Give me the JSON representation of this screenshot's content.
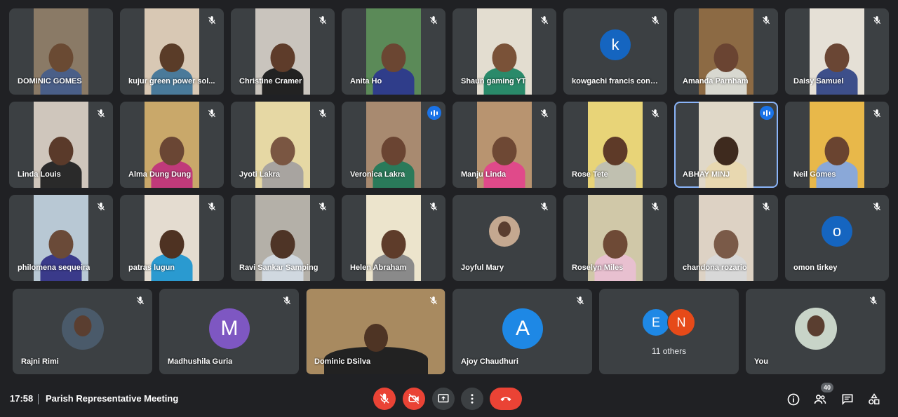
{
  "meeting": {
    "time": "17:58",
    "title": "Parish Representative Meeting",
    "participant_count": "40"
  },
  "colors": {
    "background": "#202124",
    "tile": "#3c4043",
    "danger": "#ea4335",
    "speaking_outline": "#8ab4f8",
    "speaking_badge": "#1a73e8"
  },
  "grid_rows": [
    [
      {
        "name": "DOMINIC GOMES",
        "kind": "video",
        "bg": "#8a7a66",
        "skin": "#6a4a33",
        "shirt": "#4a5f88",
        "muted": false
      },
      {
        "name": "kujur green power sol...",
        "kind": "video",
        "bg": "#d8c8b4",
        "skin": "#5a3c28",
        "shirt": "#4a7a9a",
        "muted": true
      },
      {
        "name": "Christine Cramer",
        "kind": "video",
        "bg": "#c9c4bd",
        "skin": "#5e3c2a",
        "shirt": "#222",
        "muted": true
      },
      {
        "name": "Anita Ho",
        "kind": "video",
        "bg": "#5b8a58",
        "skin": "#6b4632",
        "shirt": "#2f3d8a",
        "muted": true
      },
      {
        "name": "Shaun gaming YT",
        "kind": "video",
        "bg": "#e3ddd0",
        "skin": "#7a5238",
        "shirt": "#2a8a6a",
        "muted": true
      },
      {
        "name": "kowgachi francis conv...",
        "kind": "avatar",
        "letter": "k",
        "avatar_color": "#1565c0",
        "muted": true
      },
      {
        "name": "Amanda Parnham",
        "kind": "video",
        "bg": "#8c6a44",
        "skin": "#6a4432",
        "shirt": "#d8d8d0",
        "muted": true
      },
      {
        "name": "Daisy Samuel",
        "kind": "video",
        "bg": "#e5e0d6",
        "skin": "#6a4634",
        "shirt": "#3d4f8a",
        "muted": true
      }
    ],
    [
      {
        "name": "Linda Louis",
        "kind": "video",
        "bg": "#cfc6bc",
        "skin": "#5a3a2a",
        "shirt": "#2a2a2a",
        "muted": true
      },
      {
        "name": "Alma Dung Dung",
        "kind": "video",
        "bg": "#c9a86a",
        "skin": "#6a4634",
        "shirt": "#c03a7a",
        "muted": true
      },
      {
        "name": "Jyoti Lakra",
        "kind": "video",
        "bg": "#e6d8a4",
        "skin": "#7a5642",
        "shirt": "#a8a4a0",
        "muted": true
      },
      {
        "name": "Veronica Lakra",
        "kind": "video",
        "bg": "#a88a70",
        "skin": "#6a4432",
        "shirt": "#2a7a5a",
        "muted": false,
        "speaking": true
      },
      {
        "name": "Manju Linda",
        "kind": "video",
        "bg": "#b89470",
        "skin": "#6e4834",
        "shirt": "#e04a8a",
        "muted": true
      },
      {
        "name": "Rose Tete",
        "kind": "video",
        "bg": "#e8d478",
        "skin": "#5e3a28",
        "shirt": "#c0c0b0",
        "muted": true
      },
      {
        "name": "ABHAY MINJ",
        "kind": "video",
        "bg": "#e0d8c8",
        "skin": "#3e2a1e",
        "shirt": "#e8d8b0",
        "muted": false,
        "speaking": true,
        "highlight": true
      },
      {
        "name": "Neil Gomes",
        "kind": "video",
        "bg": "#e8b84a",
        "skin": "#6a4430",
        "shirt": "#8aa8d8",
        "muted": true
      }
    ],
    [
      {
        "name": "philomena sequeira",
        "kind": "video",
        "bg": "#b8c8d4",
        "skin": "#6a4a38",
        "shirt": "#3a3a8a",
        "muted": true
      },
      {
        "name": "patras lugun",
        "kind": "video",
        "bg": "#e4dcd0",
        "skin": "#4e3222",
        "shirt": "#2a9ad0",
        "muted": true
      },
      {
        "name": "Ravi Sankar Samping",
        "kind": "video",
        "bg": "#b4b0a8",
        "skin": "#4e3426",
        "shirt": "#d0d8e0",
        "muted": true
      },
      {
        "name": "Helen Abraham",
        "kind": "video",
        "bg": "#ece4cc",
        "skin": "#5e3c2a",
        "shirt": "#8a8a8a",
        "muted": true
      },
      {
        "name": "Joyful Mary",
        "kind": "photo",
        "avatar_color": "#c4a890",
        "muted": true
      },
      {
        "name": "Roselyn Miles",
        "kind": "video",
        "bg": "#d0c8a8",
        "skin": "#6e4a36",
        "shirt": "#e8c0d0",
        "muted": true
      },
      {
        "name": "chandona rozario",
        "kind": "video",
        "bg": "#ddd2c4",
        "skin": "#7a5a48",
        "shirt": "#d8d8d8",
        "muted": true
      },
      {
        "name": "omon tirkey",
        "kind": "avatar",
        "letter": "o",
        "avatar_color": "#1565c0",
        "muted": true
      }
    ]
  ],
  "bottom_row": [
    {
      "name": "Rajni Rimi",
      "kind": "photo",
      "avatar_color": "#4a5a6a",
      "muted": true
    },
    {
      "name": "Madhushila Guria",
      "kind": "avatar",
      "letter": "M",
      "avatar_color": "#7e57c2",
      "muted": true
    },
    {
      "name": "Dominic DSilva",
      "kind": "video",
      "bg": "#a88a60",
      "skin": "#4e3424",
      "shirt": "#222",
      "muted": true
    },
    {
      "name": "Ajoy Chaudhuri",
      "kind": "avatar",
      "letter": "A",
      "avatar_color": "#1e88e5",
      "muted": true
    },
    {
      "name": "11 others",
      "kind": "others",
      "letters": [
        "E",
        "N"
      ],
      "colors": [
        "#1e88e5",
        "#e64a19"
      ],
      "muted": false
    },
    {
      "name": "You",
      "kind": "photo",
      "avatar_color": "#c8d4c8",
      "muted": true
    }
  ],
  "controls": {
    "mic": "mic-off-icon",
    "camera": "camera-off-icon",
    "present": "present-icon",
    "more": "more-vert-icon",
    "leave": "end-call-icon"
  },
  "right_tools": [
    "info-icon",
    "people-icon",
    "chat-icon",
    "activities-icon"
  ]
}
